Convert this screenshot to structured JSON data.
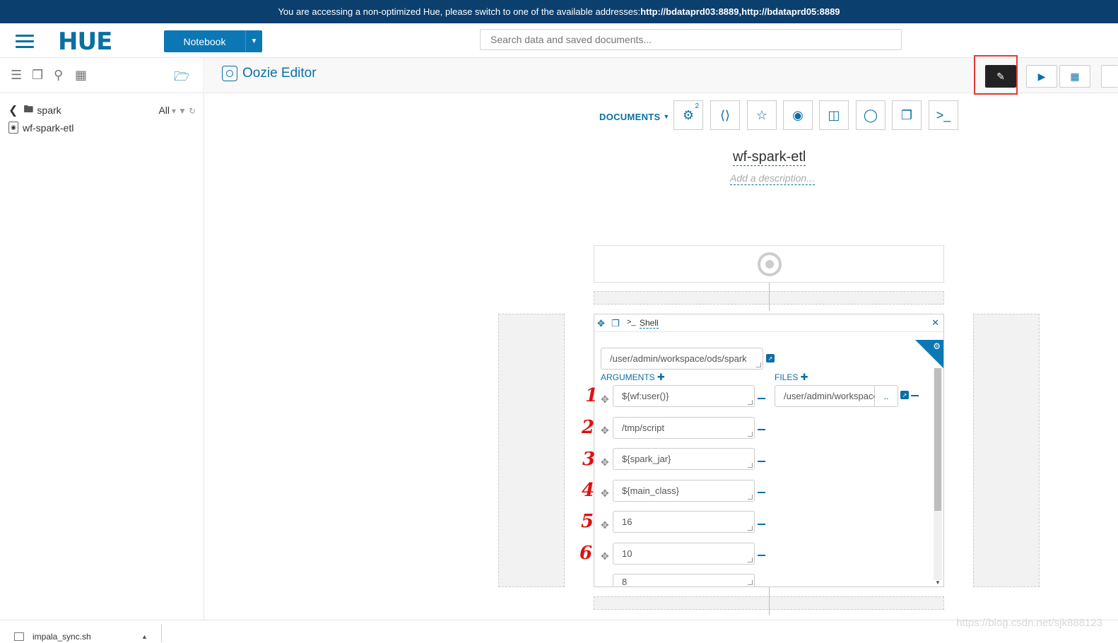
{
  "banner": {
    "text": "You are accessing a non-optimized Hue, please switch to one of the available addresses: ",
    "addr1": "http://bdataprd03:8889",
    "sep": ", ",
    "addr2": "http://bdataprd05:8889"
  },
  "header": {
    "logo": "HUE",
    "notebook_label": "Notebook",
    "search_placeholder": "Search data and saved documents..."
  },
  "sidebar": {
    "folder": "spark",
    "filter_label": "All",
    "items": [
      {
        "label": "wf-spark-etl"
      }
    ]
  },
  "editor": {
    "title": "Oozie Editor",
    "documents_label": "DOCUMENTS",
    "doc_badge": "2",
    "workflow_name": "wf-spark-etl",
    "description_placeholder": "Add a description..."
  },
  "shell": {
    "title": "Shell",
    "command": "/user/admin/workspace/ods/spark",
    "arguments_label": "ARGUMENTS",
    "files_label": "FILES",
    "arguments": [
      "${wf:user()}",
      "/tmp/script",
      "${spark_jar}",
      "${main_class}",
      "16",
      "10",
      "8"
    ],
    "file": "/user/admin/workspace",
    "files_browse": ".."
  },
  "annotations": [
    "1",
    "2",
    "3",
    "4",
    "5",
    "6"
  ],
  "bottombar": {
    "task": "impala_sync.sh"
  },
  "watermark": "https://blog.csdn.net/sjk888123",
  "colors": {
    "accent": "#0b6fa4",
    "banner": "#0b3f6e",
    "highlight": "#e53935"
  }
}
